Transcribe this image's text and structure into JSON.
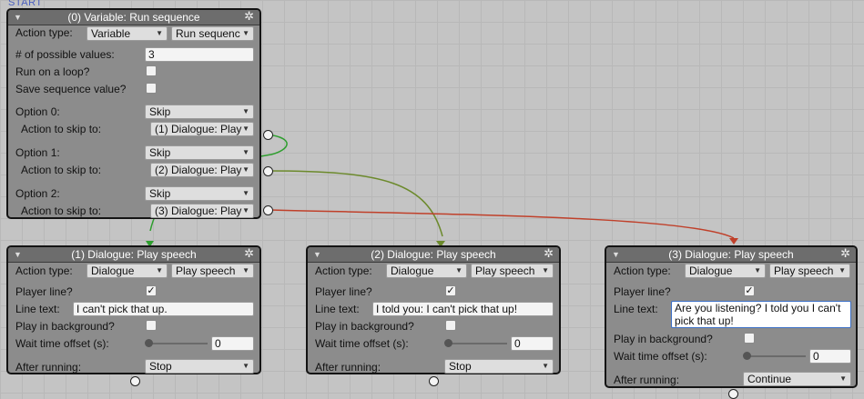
{
  "canvas": {
    "start_label": "START"
  },
  "colors": {
    "wire_green": "#2e9e2e",
    "wire_olive": "#6c8a2c",
    "wire_red": "#c0402a"
  },
  "node0": {
    "title": "(0) Variable: Run sequence",
    "action_type_label": "Action type:",
    "action_type_value": "Variable",
    "action_subtype_value": "Run sequenc",
    "possible_values_label": "# of possible values:",
    "possible_values_value": "3",
    "run_loop_label": "Run on a loop?",
    "save_seq_label": "Save sequence value?",
    "options": [
      {
        "label": "Option 0:",
        "value": "Skip",
        "skip_label": "Action to skip to:",
        "skip_value": "(1) Dialogue: Play"
      },
      {
        "label": "Option 1:",
        "value": "Skip",
        "skip_label": "Action to skip to:",
        "skip_value": "(2) Dialogue: Play"
      },
      {
        "label": "Option 2:",
        "value": "Skip",
        "skip_label": "Action to skip to:",
        "skip_value": "(3) Dialogue: Play"
      }
    ]
  },
  "nodes": [
    {
      "title": "(1) Dialogue: Play speech",
      "action_type_label": "Action type:",
      "action_type_value": "Dialogue",
      "action_subtype_value": "Play speech",
      "player_line_label": "Player line?",
      "line_text_label": "Line text:",
      "line_text_value": "I can't pick that up.",
      "background_label": "Play in background?",
      "wait_label": "Wait time offset (s):",
      "wait_value": "0",
      "after_label": "After running:",
      "after_value": "Stop"
    },
    {
      "title": "(2) Dialogue: Play speech",
      "action_type_label": "Action type:",
      "action_type_value": "Dialogue",
      "action_subtype_value": "Play speech",
      "player_line_label": "Player line?",
      "line_text_label": "Line text:",
      "line_text_value": "I told you: I can't pick that up!",
      "background_label": "Play in background?",
      "wait_label": "Wait time offset (s):",
      "wait_value": "0",
      "after_label": "After running:",
      "after_value": "Stop"
    },
    {
      "title": "(3) Dialogue: Play speech",
      "action_type_label": "Action type:",
      "action_type_value": "Dialogue",
      "action_subtype_value": "Play speech",
      "player_line_label": "Player line?",
      "line_text_label": "Line text:",
      "line_text_value": "Are you listening? I told you I can't pick that up!",
      "background_label": "Play in background?",
      "wait_label": "Wait time offset (s):",
      "wait_value": "0",
      "after_label": "After running:",
      "after_value": "Continue"
    }
  ]
}
